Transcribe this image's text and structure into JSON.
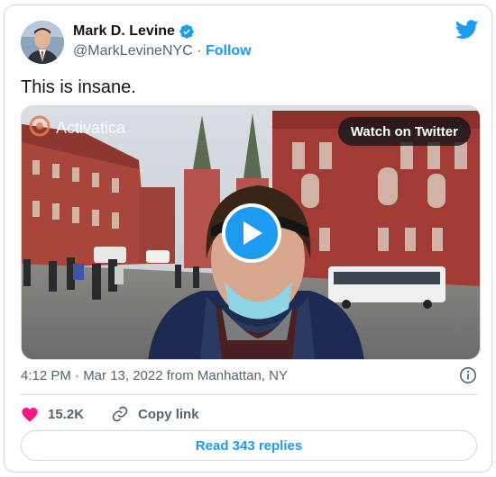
{
  "author": {
    "name": "Mark D. Levine",
    "handle": "@MarkLevineNYC",
    "separator": "·",
    "follow_label": "Follow"
  },
  "tweet": {
    "text": "This is insane.",
    "timestamp": "4:12 PM · Mar 13, 2022 from Manhattan, NY"
  },
  "media": {
    "watermark": "Activatica",
    "watch_label": "Watch on Twitter"
  },
  "actions": {
    "like_count": "15.2K",
    "copy_label": "Copy link",
    "replies_label": "Read 343 replies"
  },
  "colors": {
    "accent": "#1d9bf0",
    "like": "#f91880",
    "secondary_text": "#536471"
  },
  "icons": [
    "avatar",
    "verified-badge-icon",
    "twitter-bird-icon",
    "activatica-logo-icon",
    "play-icon",
    "info-icon",
    "heart-icon",
    "link-icon"
  ]
}
